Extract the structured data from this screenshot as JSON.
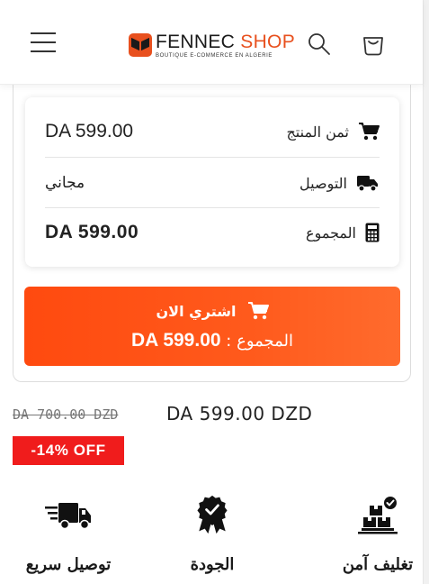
{
  "header": {
    "logo_word1": "FENNEC ",
    "logo_word2": "SHOP",
    "logo_tagline": "BOUTIQUE  E-COMMERCE  EN  ALGERIE",
    "icons": [
      "menu-icon",
      "search-icon",
      "cart-icon"
    ]
  },
  "summary": {
    "product_price_label": "ثمن المنتج",
    "product_price_value": "DA 599.00",
    "delivery_label": "التوصيل",
    "delivery_value": "مجاني",
    "total_label": "المجموع",
    "total_value": "DA 599.00"
  },
  "buy_button": {
    "label": "اشتري الان",
    "total_text": "DA 599.00",
    "total_suffix": " : المجموع"
  },
  "price": {
    "old": "DA 700.00 DZD",
    "current": "DA 599.00 DZD",
    "discount_badge": "-14% OFF"
  },
  "features": [
    {
      "label": "تغليف آمن",
      "icon": "secure-package-icon"
    },
    {
      "label": "الجودة",
      "icon": "quality-badge-icon"
    },
    {
      "label": "توصيل سريع",
      "icon": "fast-delivery-icon"
    }
  ],
  "colors": {
    "accent": "#ff5a1c",
    "brand": "#e8501e",
    "discount": "#f01c1c"
  }
}
